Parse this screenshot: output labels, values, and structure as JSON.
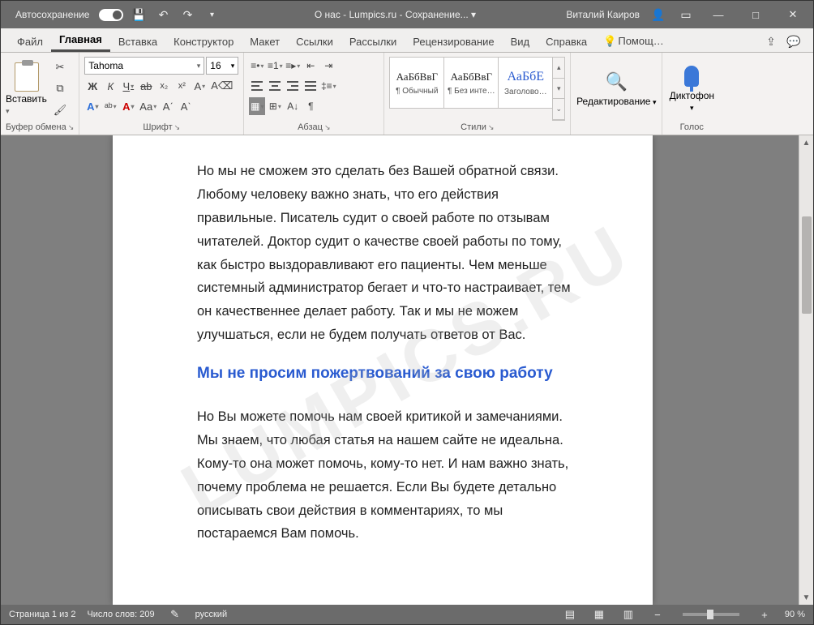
{
  "titlebar": {
    "autosave": "Автосохранение",
    "doc_title": "О нас - Lumpics.ru - Сохранение... ▾",
    "user": "Виталий Каиров"
  },
  "tabs": {
    "file": "Файл",
    "home": "Главная",
    "insert": "Вставка",
    "designer": "Конструктор",
    "layout": "Макет",
    "refs": "Ссылки",
    "mail": "Рассылки",
    "review": "Рецензирование",
    "view": "Вид",
    "help": "Справка",
    "tellme": "Помощ…"
  },
  "clipboard": {
    "label": "Вставить",
    "group": "Буфер обмена"
  },
  "font": {
    "name": "Tahoma",
    "size": "16",
    "group": "Шрифт",
    "bold": "Ж",
    "italic": "К",
    "under": "Ч",
    "strike": "ab",
    "sub": "x₂",
    "sup": "x²",
    "fxA": "A",
    "highA": "ᵃᵇ",
    "colorA": "A",
    "aa": "Aa",
    "grow": "Aˊ",
    "shrink": "Aˋ",
    "clear": "A⌫"
  },
  "para": {
    "group": "Абзац",
    "pilcrow": "¶",
    "sortAZ": "А↓"
  },
  "styles": {
    "group": "Стили",
    "preview": "АаБбВвГ",
    "s1": "¶ Обычный",
    "s2": "¶ Без инте…",
    "s3": "Заголово…"
  },
  "editing": {
    "label": "Редактирование"
  },
  "voice": {
    "label": "Диктофон",
    "group": "Голос"
  },
  "watermark": "LUMPICS.RU",
  "document": {
    "p1": "Но мы не сможем это сделать без Вашей обратной связи. Любому человеку важно знать, что его действия правильные. Писатель судит о своей работе по отзывам читателей. Доктор судит о качестве своей работы по тому, как быстро выздоравливают его пациенты. Чем меньше системный администратор бегает и что-то настраивает, тем он качественнее делает работу. Так и мы не можем улучшаться, если не будем получать ответов от Вас.",
    "h1": "Мы не просим пожертвований за свою работу",
    "p2": "Но Вы можете помочь нам своей критикой и замечаниями. Мы знаем, что любая статья на нашем сайте не идеальна. Кому-то она может помочь, кому-то нет. И нам важно знать, почему проблема не решается. Если Вы будете детально описывать свои действия в комментариях, то мы постараемся Вам помочь."
  },
  "status": {
    "page": "Страница 1 из 2",
    "words": "Число слов: 209",
    "lang": "русский",
    "zoom": "90 %"
  }
}
